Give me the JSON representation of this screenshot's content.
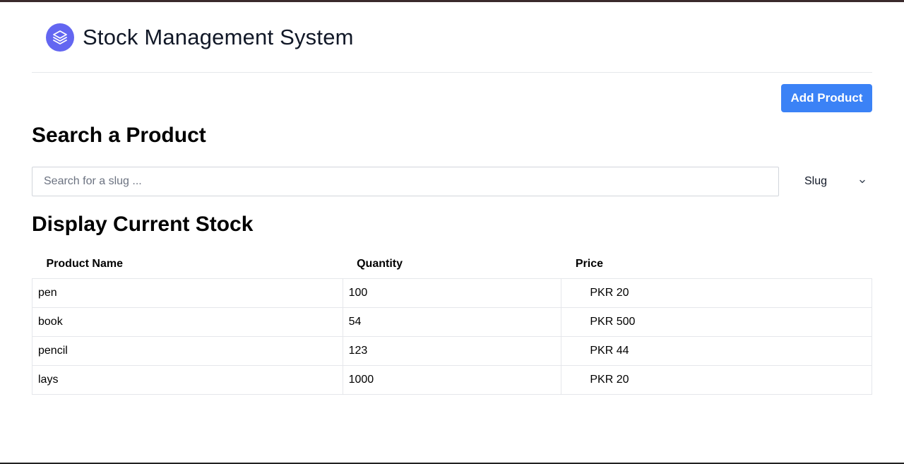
{
  "app": {
    "title": "Stock Management System",
    "logo_icon": "layers-icon",
    "accent_color": "#6366f1"
  },
  "toolbar": {
    "add_label": "Add Product",
    "button_color": "#3b82f6"
  },
  "search": {
    "heading": "Search a Product",
    "placeholder": "Search for a slug ...",
    "value": "",
    "filter_selected": "Slug"
  },
  "stock": {
    "heading": "Display Current Stock",
    "columns": [
      "Product Name",
      "Quantity",
      "Price"
    ],
    "rows": [
      {
        "name": "pen",
        "quantity": "100",
        "price": "PKR 20"
      },
      {
        "name": "book",
        "quantity": "54",
        "price": "PKR 500"
      },
      {
        "name": "pencil",
        "quantity": "123",
        "price": "PKR 44"
      },
      {
        "name": "lays",
        "quantity": "1000",
        "price": "PKR 20"
      }
    ]
  }
}
